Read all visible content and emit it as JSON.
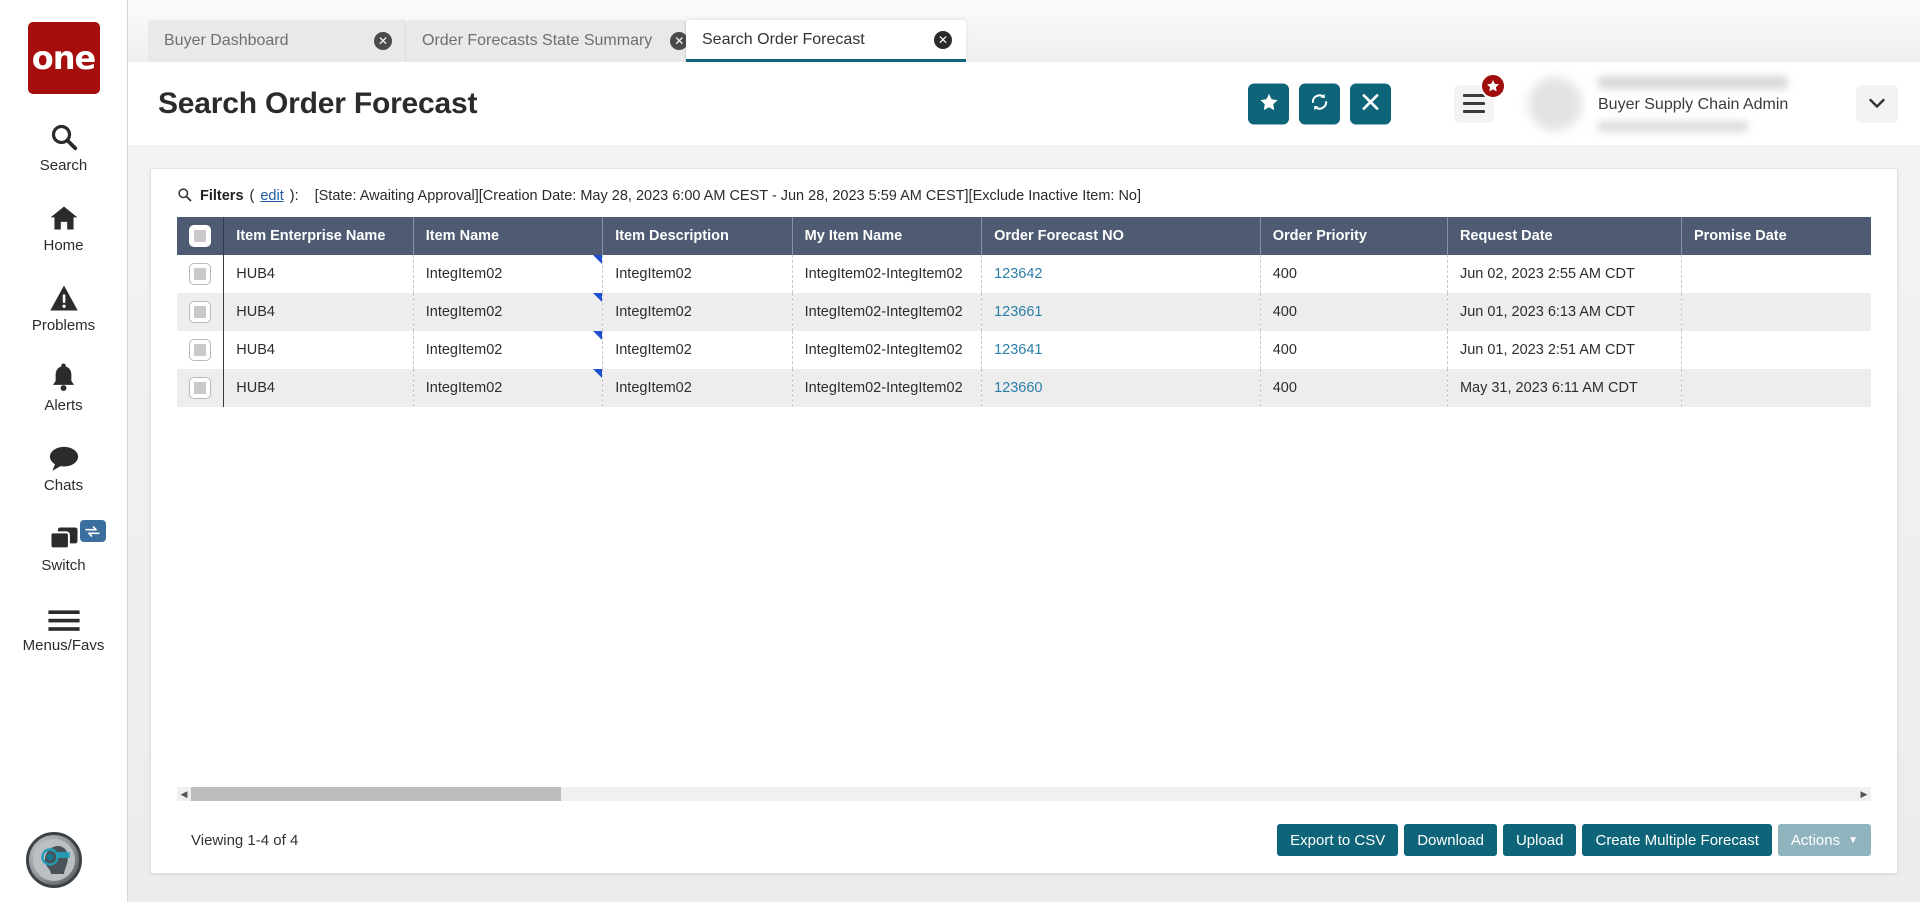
{
  "brand": {
    "logo_text": "one",
    "accent": "#0e6579",
    "header_bg": "#4e5b73",
    "logo_bg": "#a60d0d"
  },
  "sidebar": {
    "items": [
      {
        "label": "Search",
        "icon": "search-icon"
      },
      {
        "label": "Home",
        "icon": "home-icon"
      },
      {
        "label": "Problems",
        "icon": "warning-triangle-icon"
      },
      {
        "label": "Alerts",
        "icon": "bell-icon"
      },
      {
        "label": "Chats",
        "icon": "chat-bubble-icon"
      },
      {
        "label": "Switch",
        "icon": "windows-stack-icon",
        "badge_icon": "swap-arrows-icon"
      },
      {
        "label": "Menus/Favs",
        "icon": "hamburger-icon"
      }
    ],
    "assistant_icon": "ai-assistant-avatar-icon"
  },
  "tabs": [
    {
      "label": "Buyer Dashboard",
      "active": false,
      "close_icon": "close-circle-icon"
    },
    {
      "label": "Order Forecasts State Summary",
      "active": false,
      "close_icon": "close-circle-icon"
    },
    {
      "label": "Search Order Forecast",
      "active": true,
      "close_icon": "close-circle-icon"
    }
  ],
  "header": {
    "title": "Search Order Forecast",
    "actions": [
      {
        "name": "favorite-button",
        "icon": "star-icon",
        "glyph": "★"
      },
      {
        "name": "refresh-button",
        "icon": "refresh-icon",
        "glyph": "↻"
      },
      {
        "name": "close-button",
        "icon": "close-x-icon",
        "glyph": "✕"
      }
    ],
    "menu_icon": "hamburger-menu-icon",
    "menu_badge_icon": "star-badge-icon",
    "menu_badge_glyph": "★",
    "avatar_icon": "user-avatar",
    "user_role": "Buyer Supply Chain Admin",
    "caret_icon": "chevron-down-icon",
    "caret_glyph": "⌄"
  },
  "filters": {
    "icon": "search-icon",
    "label": "Filters",
    "edit_label": "edit",
    "open_paren": "(",
    "close_paren": "):",
    "values": "[State: Awaiting Approval][Creation Date: May 28, 2023 6:00 AM CEST - Jun 28, 2023 5:59 AM CEST][Exclude Inactive Item: No]"
  },
  "table": {
    "select_all_name": "select-all-checkbox",
    "columns": [
      "Item Enterprise Name",
      "Item Name",
      "Item Description",
      "My Item Name",
      "Order Forecast NO",
      "Order Priority",
      "Request Date",
      "Promise Date"
    ],
    "rows": [
      {
        "item_enterprise_name": "HUB4",
        "item_name": "IntegItem02",
        "item_description": "IntegItem02",
        "my_item_name": "IntegItem02-IntegItem02",
        "order_forecast_no": "123642",
        "order_priority": "400",
        "request_date": "Jun 02, 2023 2:55 AM CDT",
        "promise_date": ""
      },
      {
        "item_enterprise_name": "HUB4",
        "item_name": "IntegItem02",
        "item_description": "IntegItem02",
        "my_item_name": "IntegItem02-IntegItem02",
        "order_forecast_no": "123661",
        "order_priority": "400",
        "request_date": "Jun 01, 2023 6:13 AM CDT",
        "promise_date": ""
      },
      {
        "item_enterprise_name": "HUB4",
        "item_name": "IntegItem02",
        "item_description": "IntegItem02",
        "my_item_name": "IntegItem02-IntegItem02",
        "order_forecast_no": "123641",
        "order_priority": "400",
        "request_date": "Jun 01, 2023 2:51 AM CDT",
        "promise_date": ""
      },
      {
        "item_enterprise_name": "HUB4",
        "item_name": "IntegItem02",
        "item_description": "IntegItem02",
        "my_item_name": "IntegItem02-IntegItem02",
        "order_forecast_no": "123660",
        "order_priority": "400",
        "request_date": "May 31, 2023 6:11 AM CDT",
        "promise_date": ""
      }
    ]
  },
  "scrollbar": {
    "left_arrow_glyph": "◀",
    "right_arrow_glyph": "▶"
  },
  "footer": {
    "viewing": "Viewing 1-4 of 4",
    "buttons": [
      {
        "label": "Export to CSV",
        "style": "primary"
      },
      {
        "label": "Download",
        "style": "primary"
      },
      {
        "label": "Upload",
        "style": "primary"
      },
      {
        "label": "Create Multiple Forecast",
        "style": "primary"
      },
      {
        "label": "Actions",
        "style": "muted",
        "caret_glyph": "▼"
      }
    ]
  }
}
